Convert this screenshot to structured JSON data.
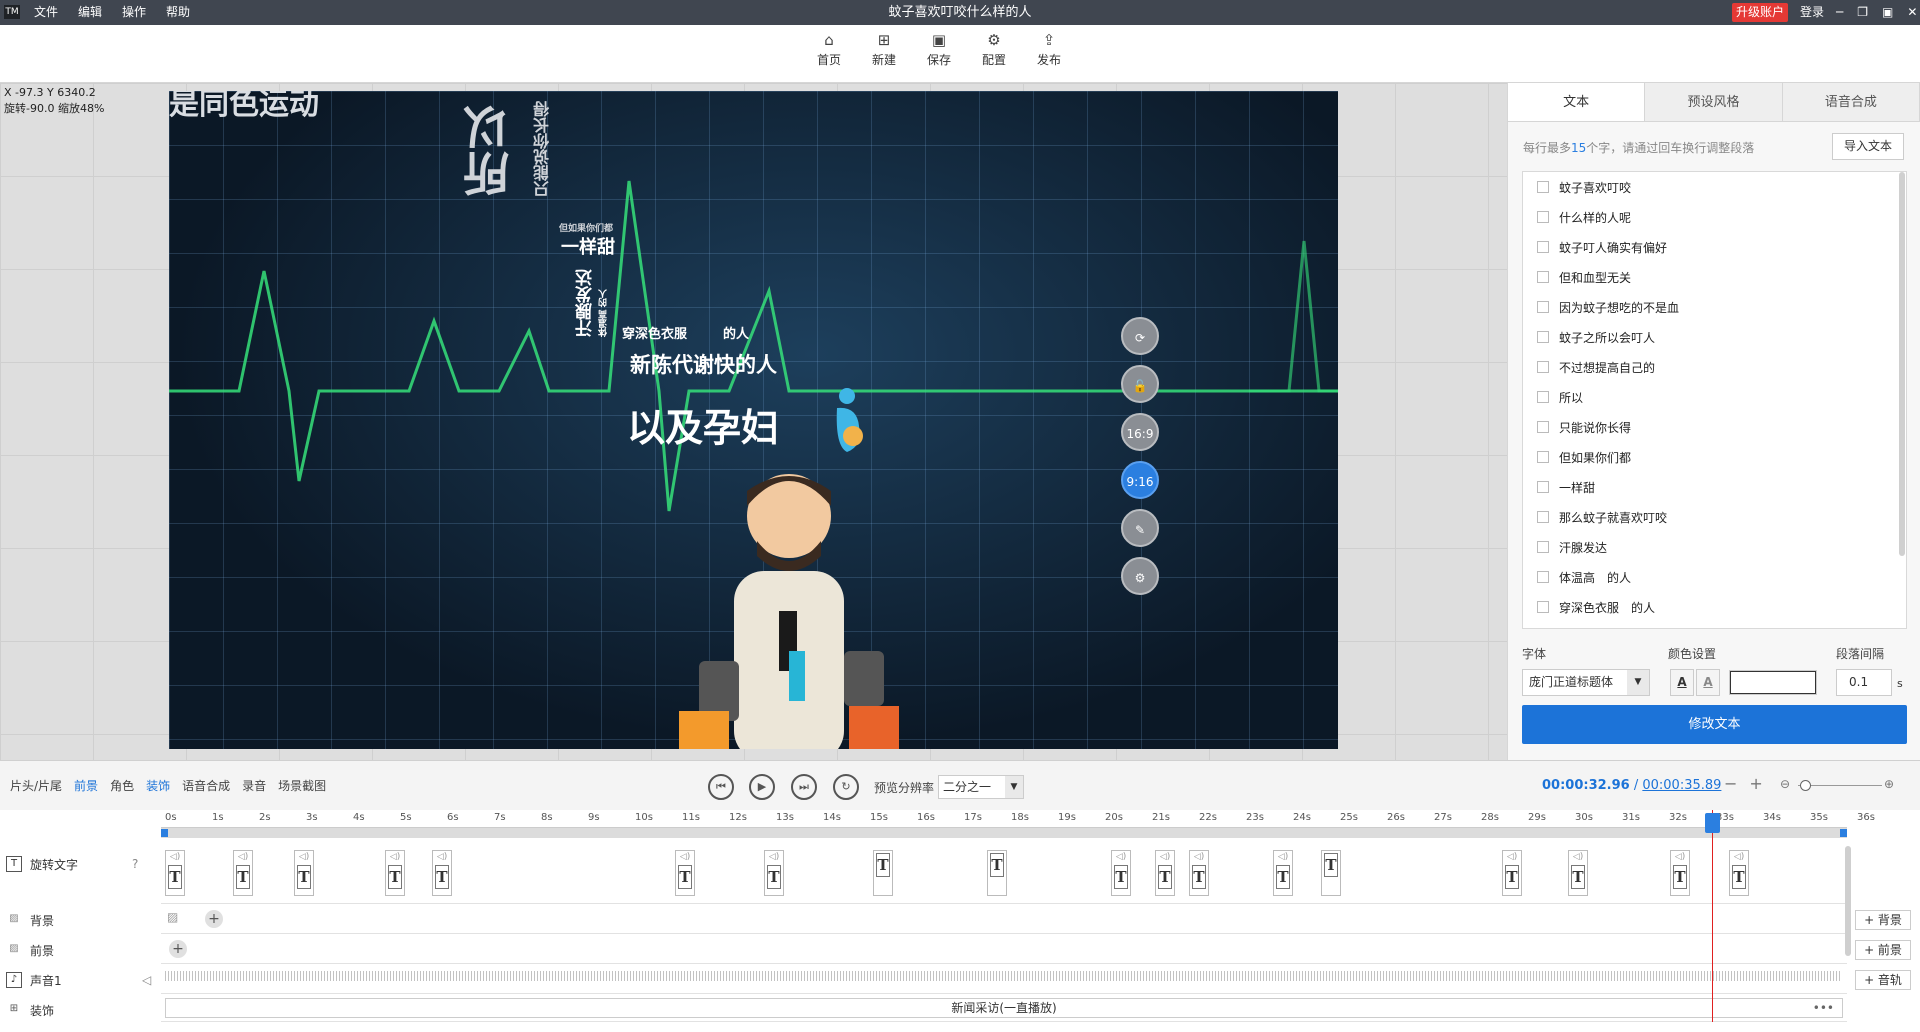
{
  "app": {
    "logo": "TM",
    "title": "蚊子喜欢叮咬什么样的人",
    "menu": [
      "文件",
      "编辑",
      "操作",
      "帮助"
    ],
    "upgrade": "升级账户",
    "login": "登录",
    "window_controls": [
      "─",
      "❐",
      "▣",
      "✕"
    ]
  },
  "toolbar": {
    "items": [
      {
        "label": "首页",
        "icon": "home-icon",
        "glyph": "⌂"
      },
      {
        "label": "新建",
        "icon": "new-file-icon",
        "glyph": "⊞"
      },
      {
        "label": "保存",
        "icon": "save-icon",
        "glyph": "▣"
      },
      {
        "label": "配置",
        "icon": "settings-icon",
        "glyph": "⚙"
      },
      {
        "label": "发布",
        "icon": "publish-icon",
        "glyph": "⇪"
      }
    ]
  },
  "canvas": {
    "coords": "X -97.3 Y 6340.2",
    "rotate_zoom": "旋转-90.0 缩放48%",
    "stage_texts": {
      "top_cut": "是同色运动",
      "suoyi": "所以",
      "zhineng": "只能说你长得",
      "small1": "但如果你们都",
      "yiyangtian": "一样甜",
      "hanxian": "汗腺发达",
      "tiwengao": "体温高 的人",
      "chuanshen": "穿深色衣服",
      "chuanshen_tail": "的人",
      "xinchen": "新陈代谢快的人",
      "yunfu": "以及孕妇"
    },
    "side_tools": [
      {
        "name": "rotate-icon",
        "text": "⟳"
      },
      {
        "name": "unlock-icon",
        "text": "🔓"
      },
      {
        "name": "ratio-16-9-button",
        "text": "16:9"
      },
      {
        "name": "ratio-9-16-button",
        "text": "9:16",
        "active": true
      },
      {
        "name": "edit-icon",
        "text": "✎"
      },
      {
        "name": "settings-icon",
        "text": "⚙"
      }
    ]
  },
  "right_panel": {
    "tabs": [
      "文本",
      "预设风格",
      "语音合成"
    ],
    "hint_prefix": "每行最多",
    "hint_num": "15",
    "hint_suffix": "个字，请通过回车换行调整段落",
    "import_btn": "导入文本",
    "lines": [
      "蚊子喜欢叮咬",
      "什么样的人呢",
      "蚊子叮人确实有偏好",
      "但和血型无关",
      "因为蚊子想吃的不是血",
      "蚊子之所以会叮人",
      "不过想提高自己的",
      "所以",
      "只能说你长得",
      "但如果你们都",
      "一样甜",
      "那么蚊子就喜欢叮咬",
      "汗腺发达",
      "体温高　的人",
      "穿深色衣服　的人"
    ],
    "font_label": "字体",
    "font_value": "庞门正道标题体",
    "color_label": "颜色设置",
    "spacing_label": "段落间隔",
    "spacing_value": "0.1",
    "spacing_unit": "s",
    "modify_btn": "修改文本"
  },
  "playbar": {
    "tools": [
      "片头/片尾",
      "前景",
      "角色",
      "装饰",
      "语音合成",
      "录音",
      "场景截图"
    ],
    "active_tools": [
      "前景",
      "装饰"
    ],
    "res_label": "预览分辨率",
    "res_value": "二分之一",
    "current_time": "00:00:32.96",
    "separator": " / ",
    "total_time": "00:00:35.89"
  },
  "timeline": {
    "ticks": [
      "0s",
      "1s",
      "2s",
      "3s",
      "4s",
      "5s",
      "6s",
      "7s",
      "8s",
      "9s",
      "10s",
      "11s",
      "12s",
      "13s",
      "14s",
      "15s",
      "16s",
      "17s",
      "18s",
      "19s",
      "20s",
      "21s",
      "22s",
      "23s",
      "24s",
      "25s",
      "26s",
      "27s",
      "28s",
      "29s",
      "30s",
      "31s",
      "32s",
      "33s",
      "34s",
      "35s",
      "36s"
    ],
    "tracks": {
      "text": "旋转文字",
      "bg": "背景",
      "fg": "前景",
      "audio": "声音1",
      "deco": "装饰"
    },
    "side_buttons": {
      "bg": "+ 背景",
      "fg": "+ 前景",
      "audio": "+ 音轨"
    },
    "deco_clip": "新闻采访(一直播放)",
    "deco_dots": "•••"
  }
}
